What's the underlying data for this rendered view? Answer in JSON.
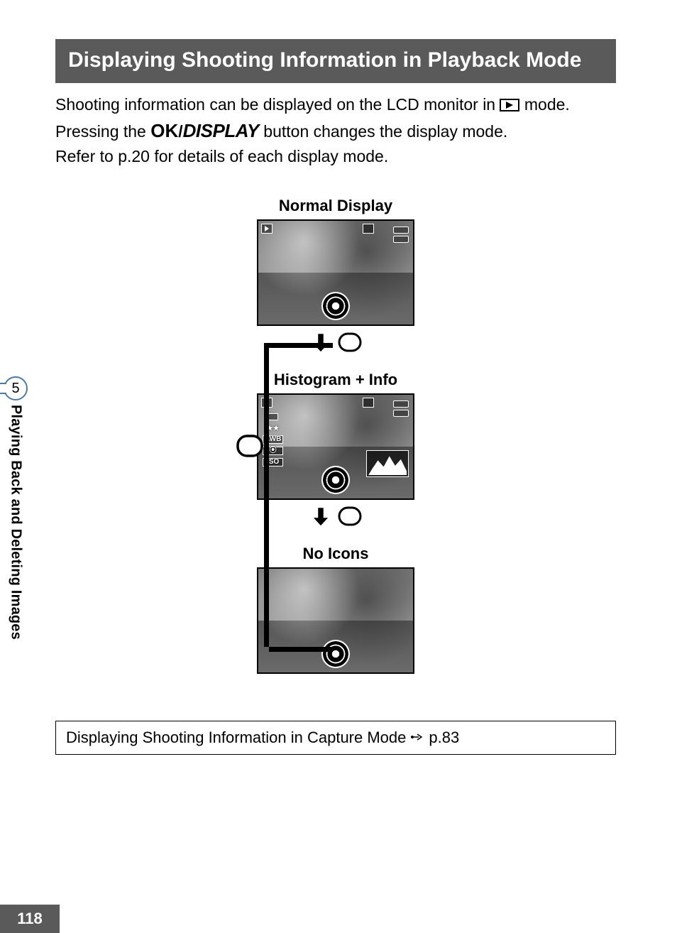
{
  "heading": "Displaying Shooting Information in Playback Mode",
  "para": {
    "line1a": "Shooting information can be displayed on the LCD monitor in ",
    "line1b": " mode.",
    "line2a": "Pressing the ",
    "ok": "OK",
    "slash": "/",
    "display": "DISPLAY",
    "line2b": " button changes the display mode.",
    "line3": "Refer to p.20 for details of each display mode."
  },
  "labels": {
    "normal": "Normal Display",
    "hist": "Histogram + Info",
    "noicons": "No Icons"
  },
  "lcd2_icons": {
    "stars": "★★",
    "awb": "AWB",
    "meter": "⦿",
    "iso": "ISO"
  },
  "xref": {
    "text": "Displaying Shooting Information in Capture Mode ",
    "page": "p.83"
  },
  "side": {
    "chapter": "5",
    "title": "Playing Back and Deleting Images"
  },
  "pagenum": "118"
}
